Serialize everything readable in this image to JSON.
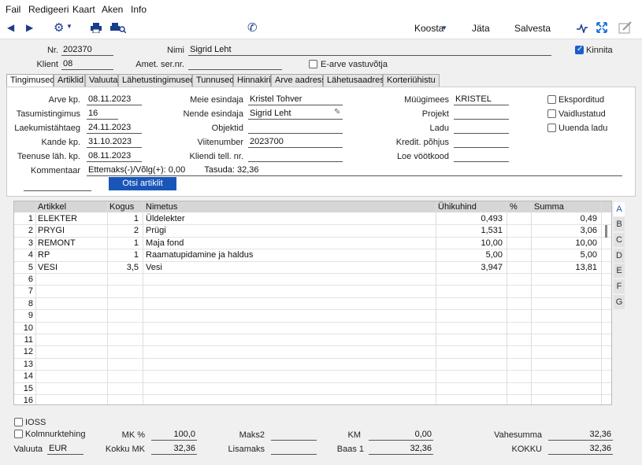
{
  "menu": [
    "Fail",
    "Redigeeri",
    "Kaart",
    "Aken",
    "Info"
  ],
  "toolbar": {
    "koosta": "Koosta",
    "jata": "Jäta",
    "salvesta": "Salvesta"
  },
  "header": {
    "nr_label": "Nr.",
    "nr": "202370",
    "nimi_label": "Nimi",
    "nimi": "Sigrid Leht",
    "klient_label": "Klient",
    "klient": "08",
    "amet_label": "Amet. ser.nr.",
    "amet": "",
    "earve_label": "E-arve vastuvõtja",
    "kinnita_label": "Kinnita"
  },
  "tabs": [
    "Tingimused",
    "Artiklid",
    "Valuuta",
    "Lähetustingimused",
    "Tunnused",
    "Hinnakiri",
    "Arve aadress",
    "Lähetusaadress",
    "Korteriühistu"
  ],
  "form": {
    "arve_kp_label": "Arve kp.",
    "arve_kp": "08.11.2023",
    "tasum_label": "Tasumistingimus",
    "tasum": "16",
    "laekum_label": "Laekumistähtaeg",
    "laekum": "24.11.2023",
    "kande_label": "Kande kp.",
    "kande": "31.10.2023",
    "teenuse_label": "Teenuse läh. kp.",
    "teenuse": "08.11.2023",
    "komm_label": "Kommentaar",
    "komm": "Ettemaks(-)/Võlg(+): 0,00        Tasuda: 32,36",
    "meie_label": "Meie esindaja",
    "meie": "Kristel Tohver",
    "nende_label": "Nende esindaja",
    "nende": "Sigrid Leht",
    "objektid_label": "Objektid",
    "objektid": "",
    "viite_label": "Viitenumber",
    "viite": "2023700",
    "kliendi_label": "Kliendi tell. nr.",
    "kliendi": "",
    "myygi_label": "Müügimees",
    "myygi": "KRISTEL",
    "projekt_label": "Projekt",
    "projekt": "",
    "ladu_label": "Ladu",
    "ladu": "",
    "kredit_label": "Kredit. põhjus",
    "kredit": "",
    "loe_label": "Loe vöötkood",
    "loe": "",
    "eksport_label": "Eksporditud",
    "vaidl_label": "Vaidlustatud",
    "uuenda_label": "Uuenda ladu",
    "otsi_button": "Otsi artiklit"
  },
  "grid": {
    "headers": [
      "Artikkel",
      "Kogus",
      "Nimetus",
      "Ühikuhind",
      "%",
      "Summa"
    ],
    "rows": [
      {
        "n": "1",
        "art": "ELEKTER",
        "kogus": "1",
        "nim": "Üldelekter",
        "hind": "0,493",
        "pct": "",
        "summa": "0,49"
      },
      {
        "n": "2",
        "art": "PRYGI",
        "kogus": "2",
        "nim": "Prügi",
        "hind": "1,531",
        "pct": "",
        "summa": "3,06"
      },
      {
        "n": "3",
        "art": "REMONT",
        "kogus": "1",
        "nim": "Maja fond",
        "hind": "10,00",
        "pct": "",
        "summa": "10,00"
      },
      {
        "n": "4",
        "art": "RP",
        "kogus": "1",
        "nim": "Raamatupidamine ja haldus",
        "hind": "5,00",
        "pct": "",
        "summa": "5,00"
      },
      {
        "n": "5",
        "art": "VESI",
        "kogus": "3,5",
        "nim": "Vesi",
        "hind": "3,947",
        "pct": "",
        "summa": "13,81"
      },
      {
        "n": "6",
        "art": "",
        "kogus": "",
        "nim": "",
        "hind": "",
        "pct": "",
        "summa": ""
      },
      {
        "n": "7",
        "art": "",
        "kogus": "",
        "nim": "",
        "hind": "",
        "pct": "",
        "summa": ""
      },
      {
        "n": "8",
        "art": "",
        "kogus": "",
        "nim": "",
        "hind": "",
        "pct": "",
        "summa": ""
      },
      {
        "n": "9",
        "art": "",
        "kogus": "",
        "nim": "",
        "hind": "",
        "pct": "",
        "summa": ""
      },
      {
        "n": "10",
        "art": "",
        "kogus": "",
        "nim": "",
        "hind": "",
        "pct": "",
        "summa": ""
      },
      {
        "n": "11",
        "art": "",
        "kogus": "",
        "nim": "",
        "hind": "",
        "pct": "",
        "summa": ""
      },
      {
        "n": "12",
        "art": "",
        "kogus": "",
        "nim": "",
        "hind": "",
        "pct": "",
        "summa": ""
      },
      {
        "n": "13",
        "art": "",
        "kogus": "",
        "nim": "",
        "hind": "",
        "pct": "",
        "summa": ""
      },
      {
        "n": "14",
        "art": "",
        "kogus": "",
        "nim": "",
        "hind": "",
        "pct": "",
        "summa": ""
      },
      {
        "n": "15",
        "art": "",
        "kogus": "",
        "nim": "",
        "hind": "",
        "pct": "",
        "summa": ""
      },
      {
        "n": "16",
        "art": "",
        "kogus": "",
        "nim": "",
        "hind": "",
        "pct": "",
        "summa": ""
      }
    ],
    "side_tabs": [
      "A",
      "B",
      "C",
      "D",
      "E",
      "F",
      "G"
    ]
  },
  "footer": {
    "ioss_label": "IOSS",
    "kolm_label": "Kolmnurktehing",
    "valuuta_label": "Valuuta",
    "valuuta": "EUR",
    "mk_pct_label": "MK %",
    "mk_pct": "100,0",
    "kokku_mk_label": "Kokku MK",
    "kokku_mk": "32,36",
    "maks2_label": "Maks2",
    "maks2": "",
    "lisamaks_label": "Lisamaks",
    "lisamaks": "",
    "km_label": "KM",
    "km": "0,00",
    "baas1_label": "Baas 1",
    "baas1": "32,36",
    "vahesumma_label": "Vahesumma",
    "vahesumma": "32,36",
    "kokku_label": "KOKKU",
    "kokku": "32,36"
  },
  "colors": {
    "accent": "#1a56b8",
    "header_bg": "#d6d6d6"
  }
}
